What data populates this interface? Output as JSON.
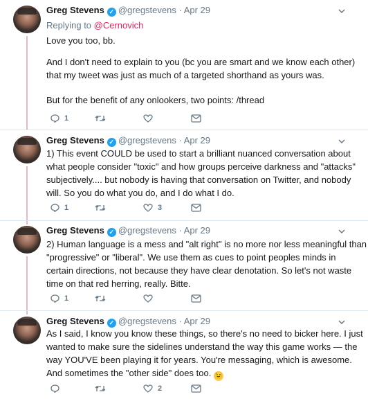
{
  "author": {
    "name": "Greg Stevens",
    "handle": "@gregstevens",
    "verified": true
  },
  "colors": {
    "thread_line": "#e8b7c9",
    "mention": "#e0245e",
    "verified": "#1da1f2",
    "meta": "#657786"
  },
  "tweets": [
    {
      "date": "Apr 29",
      "replying_prefix": "Replying to ",
      "replying_to": "@Cernovich",
      "lines": [
        "Love you too, bb.",
        "",
        "And I don't need to explain to you (bc you are smart and we know each other)",
        "that my tweet was just as much of a targeted shorthand as yours was.",
        "",
        "But for the benefit of any onlookers, two points: /thread"
      ],
      "actions": {
        "reply_count": "1",
        "retweet_count": "",
        "like_count": ""
      }
    },
    {
      "date": "Apr 29",
      "lines": [
        "1) This event COULD be used to start a brilliant nuanced conversation about",
        "what people consider \"toxic\" and how groups perceive darkness and \"attacks\"",
        "subjectively.... but nobody is having that conversation on Twitter, and nobody",
        "will. So you do what you do, and I do what I do."
      ],
      "actions": {
        "reply_count": "1",
        "retweet_count": "",
        "like_count": "3"
      }
    },
    {
      "date": "Apr 29",
      "lines": [
        "2) Human language is a mess and \"alt right\" is no more nor less meaningful than",
        "\"progressive\" or \"liberal\". We use them as cues to point peoples minds in",
        "certain directions, not because they have clear denotation. So let's not waste",
        "time on that red herring, really. Bitte."
      ],
      "actions": {
        "reply_count": "1",
        "retweet_count": "",
        "like_count": ""
      }
    },
    {
      "date": "Apr 29",
      "lines": [
        "As I said, I know you know these things, so there's no need to bicker here. I just",
        "wanted to make sure the sidelines understand the way this game works — the",
        "way YOU'VE been playing it for years. You're messaging, which is awesome.",
        "And sometimes the \"other side\" does too."
      ],
      "emoji": "wink-emoji",
      "actions": {
        "reply_count": "",
        "retweet_count": "",
        "like_count": "2"
      }
    }
  ]
}
